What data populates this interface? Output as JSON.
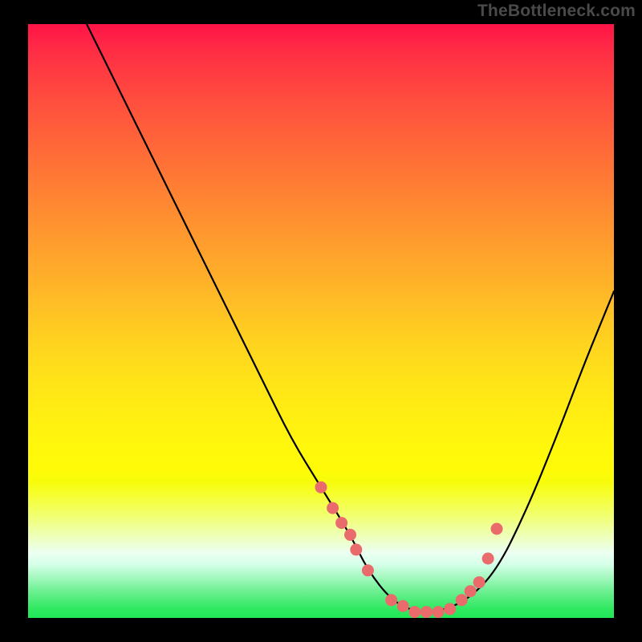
{
  "watermark": "TheBottleneck.com",
  "chart_data": {
    "type": "line",
    "title": "",
    "xlabel": "",
    "ylabel": "",
    "xlim": [
      0,
      100
    ],
    "ylim": [
      0,
      100
    ],
    "grid": false,
    "series": [
      {
        "name": "curve",
        "x": [
          10,
          15,
          20,
          25,
          30,
          35,
          40,
          45,
          50,
          55,
          58,
          62,
          66,
          70,
          75,
          80,
          85,
          90,
          95,
          100
        ],
        "y": [
          100,
          90,
          80,
          70,
          60,
          50,
          40,
          30,
          22,
          14,
          8,
          3,
          1,
          1,
          3,
          8,
          18,
          30,
          43,
          55
        ]
      }
    ],
    "scatter": {
      "name": "points",
      "color": "#e96b6b",
      "x": [
        50,
        52,
        53.5,
        55,
        56,
        58,
        62,
        64,
        66,
        68,
        70,
        72,
        74,
        75.5,
        77,
        78.5,
        80
      ],
      "y": [
        22,
        18.5,
        16,
        14,
        11.5,
        8,
        3,
        2,
        1,
        1,
        1,
        1.5,
        3,
        4.5,
        6,
        10,
        15
      ]
    }
  }
}
